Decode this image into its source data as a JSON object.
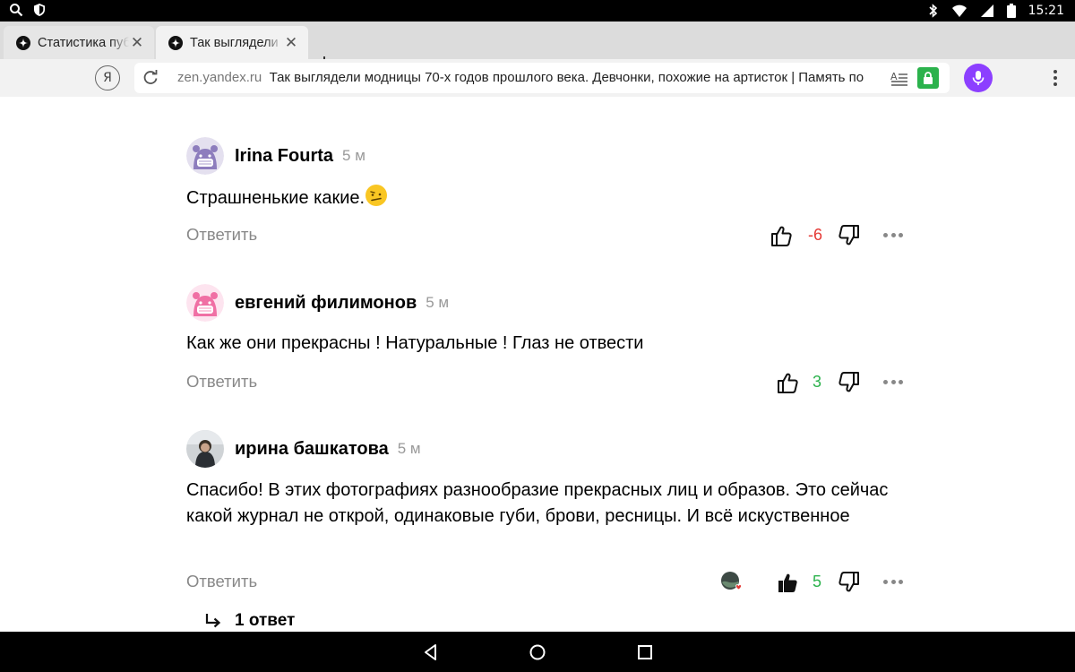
{
  "statusbar": {
    "time": "15:21"
  },
  "tabs": [
    {
      "title": "Статистика публикаций",
      "active": false
    },
    {
      "title": "Так выглядели модницы",
      "active": true
    }
  ],
  "address": {
    "domain": "zen.yandex.ru",
    "page_title": "Так выглядели модницы 70-х годов прошлого века. Девчонки, похожие на артисток | Память по"
  },
  "comments": [
    {
      "author": "Irina Fourta",
      "time": "5 м",
      "text": "Страшненькие какие.",
      "emoji": "🫤",
      "reply": "Ответить",
      "score": "-6",
      "score_color": "#e53935"
    },
    {
      "author": "евгений филимонов",
      "time": "5 м",
      "text": "Как же они прекрасны ! Натуральные ! Глаз не отвести",
      "reply": "Ответить",
      "score": "3",
      "score_color": "#2bb24c"
    },
    {
      "author": "ирина башкатова",
      "time": "5 м",
      "text": "Спасибо! В этих фотографиях разнообразие прекрасных лиц и образов. Это сейчас какой журнал не открой, одинаковые губи, брови, ресницы. И всё искуственное",
      "reply": "Ответить",
      "score": "5",
      "score_color": "#2bb24c"
    }
  ],
  "replies_link": "1 ответ",
  "colors": {
    "accent_mic": "#8c3fff",
    "lock_green": "#2bb24c",
    "negative": "#e53935",
    "positive": "#2bb24c"
  }
}
